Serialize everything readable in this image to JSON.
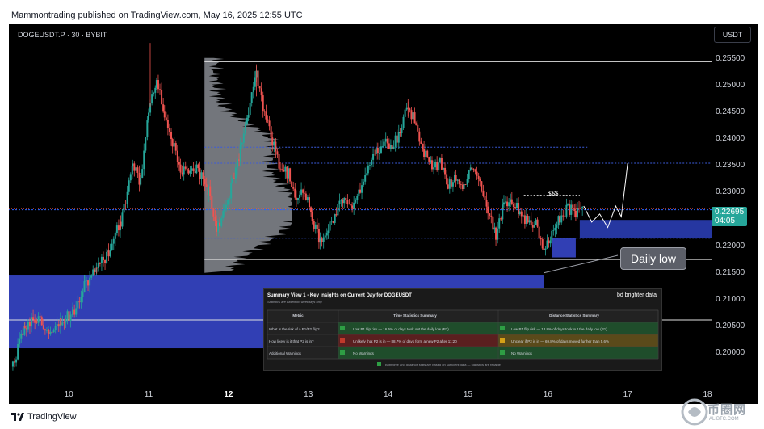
{
  "header": {
    "publisher": "Mammontrading published on TradingView.com, May 16, 2025 12:55 UTC"
  },
  "chart_data": {
    "type": "candlestick",
    "symbol": "DOGEUSDT.P · 30 · BYBIT",
    "currency": "USDT",
    "y_ticks": [
      "0.25500",
      "0.25000",
      "0.24500",
      "0.24000",
      "0.23500",
      "0.23000",
      "0.22500",
      "0.22000",
      "0.21500",
      "0.21000",
      "0.20500",
      "0.20000"
    ],
    "ylim": [
      0.1935,
      0.2615
    ],
    "x_ticks": [
      "10",
      "11",
      "12",
      "13",
      "14",
      "15",
      "16",
      "17",
      "18"
    ],
    "x_ticks_bold": [
      "12"
    ],
    "xlim": [
      9.25,
      18.05
    ],
    "current_price": "0.22695",
    "countdown": "04:05",
    "price_path": [
      [
        9.3,
        0.1975
      ],
      [
        9.45,
        0.205
      ],
      [
        9.6,
        0.2065
      ],
      [
        9.75,
        0.2045
      ],
      [
        9.9,
        0.206
      ],
      [
        10.05,
        0.2075
      ],
      [
        10.2,
        0.213
      ],
      [
        10.35,
        0.2155
      ],
      [
        10.5,
        0.219
      ],
      [
        10.65,
        0.2245
      ],
      [
        10.8,
        0.235
      ],
      [
        10.9,
        0.232
      ],
      [
        11.0,
        0.2455
      ],
      [
        11.1,
        0.251
      ],
      [
        11.2,
        0.2445
      ],
      [
        11.3,
        0.2395
      ],
      [
        11.4,
        0.234
      ],
      [
        11.5,
        0.2335
      ],
      [
        11.6,
        0.2345
      ],
      [
        11.75,
        0.2305
      ],
      [
        11.85,
        0.2235
      ],
      [
        11.95,
        0.2265
      ],
      [
        12.05,
        0.232
      ],
      [
        12.15,
        0.238
      ],
      [
        12.25,
        0.245
      ],
      [
        12.35,
        0.252
      ],
      [
        12.45,
        0.2445
      ],
      [
        12.55,
        0.2395
      ],
      [
        12.65,
        0.2345
      ],
      [
        12.75,
        0.2335
      ],
      [
        12.85,
        0.2285
      ],
      [
        12.95,
        0.2305
      ],
      [
        13.05,
        0.225
      ],
      [
        13.15,
        0.2205
      ],
      [
        13.25,
        0.2235
      ],
      [
        13.35,
        0.2265
      ],
      [
        13.45,
        0.2295
      ],
      [
        13.55,
        0.2265
      ],
      [
        13.65,
        0.2305
      ],
      [
        13.75,
        0.235
      ],
      [
        13.85,
        0.2375
      ],
      [
        13.95,
        0.2395
      ],
      [
        14.05,
        0.2385
      ],
      [
        14.15,
        0.2415
      ],
      [
        14.25,
        0.2465
      ],
      [
        14.35,
        0.2425
      ],
      [
        14.45,
        0.2375
      ],
      [
        14.55,
        0.2345
      ],
      [
        14.65,
        0.2355
      ],
      [
        14.75,
        0.2315
      ],
      [
        14.85,
        0.2325
      ],
      [
        14.95,
        0.2305
      ],
      [
        15.05,
        0.235
      ],
      [
        15.15,
        0.2325
      ],
      [
        15.25,
        0.2265
      ],
      [
        15.35,
        0.222
      ],
      [
        15.45,
        0.228
      ],
      [
        15.55,
        0.2285
      ],
      [
        15.65,
        0.2265
      ],
      [
        15.75,
        0.2245
      ],
      [
        15.85,
        0.224
      ],
      [
        15.95,
        0.2195
      ],
      [
        16.05,
        0.222
      ],
      [
        16.15,
        0.2255
      ],
      [
        16.25,
        0.227
      ],
      [
        16.35,
        0.2265
      ],
      [
        16.45,
        0.2275
      ]
    ],
    "projection_path": [
      [
        16.45,
        0.2275
      ],
      [
        16.55,
        0.2245
      ],
      [
        16.65,
        0.226
      ],
      [
        16.75,
        0.2235
      ],
      [
        16.85,
        0.2275
      ],
      [
        16.92,
        0.2255
      ],
      [
        17.0,
        0.2355
      ]
    ],
    "horizontal_lines": [
      {
        "y": 0.2545,
        "x0": 11.7,
        "x1": 18.05,
        "color": "#e0e0e0",
        "style": "solid"
      },
      {
        "y": 0.2385,
        "x0": 11.7,
        "x1": 16.5,
        "color": "#3b5bdb",
        "style": "dotted"
      },
      {
        "y": 0.2355,
        "x0": 11.7,
        "x1": 18.05,
        "color": "#3b5bdb",
        "style": "dotted"
      },
      {
        "y": 0.2268,
        "x0": 9.25,
        "x1": 18.05,
        "color": "#2962ff",
        "style": "dotted"
      },
      {
        "y": 0.2215,
        "x0": 11.7,
        "x1": 18.05,
        "color": "#3b5bdb",
        "style": "dotted"
      },
      {
        "y": 0.2175,
        "x0": 11.7,
        "x1": 18.05,
        "color": "#e0e0e0",
        "style": "solid"
      },
      {
        "y": 0.2062,
        "x0": 9.25,
        "x1": 18.05,
        "color": "#e0e0e0",
        "style": "solid"
      },
      {
        "y": 0.2295,
        "x0": 15.7,
        "x1": 16.4,
        "color": "#ffffff",
        "style": "dotted"
      }
    ],
    "zones": [
      {
        "x0": 9.25,
        "x1": 15.95,
        "y0": 0.2009,
        "y1": 0.2145,
        "color": "#3646c8"
      },
      {
        "x0": 16.05,
        "x1": 16.35,
        "y0": 0.2179,
        "y1": 0.2215,
        "color": "#3646c8"
      },
      {
        "x0": 16.4,
        "x1": 18.05,
        "y0": 0.2215,
        "y1": 0.2249,
        "color": "#2a3db3"
      }
    ],
    "volume_profile": {
      "x0": 11.7,
      "y_peak": 0.2268,
      "max_width_days": 1.1
    },
    "annotations": {
      "dollars": "$$$",
      "daily_low": "Daily low"
    }
  },
  "summary_table": {
    "title": "Summary View 1 - Key Insights on Current Day for DOGEUSDT",
    "subtitle": "Statistics are based on weekdays only",
    "brand": "bd brighter data",
    "headers": [
      "Metric",
      "Time Statistics Summary",
      "Distance Statistics Summary"
    ],
    "rows": [
      {
        "metric": "What is the risk of a P1/P2 flip?",
        "time": "Low P1 flip risk — 16.5% of days took out the daily low (P1)",
        "distance": "Low P1 flip risk — 13.8% of days took out the daily low (P1)",
        "time_status": "ok",
        "distance_status": "ok"
      },
      {
        "metric": "How likely is it that P2 is in?",
        "time": "Unlikely that P2 is in — 88.7% of days form a new P2 after 11:20",
        "distance": "Unclear if P2 is in — 69.8% of days moved further than 5.6%",
        "time_status": "bad",
        "distance_status": "warn"
      },
      {
        "metric": "Additional Warnings",
        "time": "No Warnings",
        "distance": "No Warnings",
        "time_status": "ok",
        "distance_status": "ok"
      }
    ],
    "footer": "Both time and distance stats are based on sufficient data — statistics are reliable"
  },
  "footer": {
    "brand": "TradingView"
  },
  "watermark": {
    "text": "币圈网",
    "sub": "ALIBTC.COM"
  },
  "colors": {
    "up": "#26a69a",
    "down": "#ef5350",
    "zone": "#3646c8",
    "background": "#000000"
  }
}
